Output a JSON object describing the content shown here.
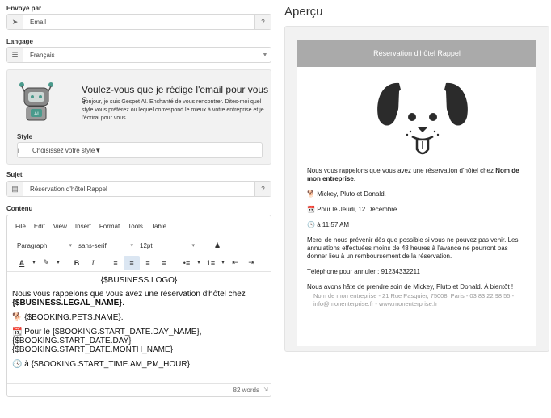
{
  "form": {
    "sender_label": "Envoyé par",
    "sender_value": "Email",
    "language_label": "Langage",
    "language_value": "Français",
    "ai": {
      "title": "Voulez-vous que je rédige l'email pour vous ?",
      "text": "Bonjour, je suis Gespet AI. Enchanté de vous rencontrer. Dites-moi quel style vous préférez ou lequel correspond le mieux à votre entreprise et je l'écrirai pour vous.",
      "style_label": "Style",
      "style_placeholder": "Choisissez votre style",
      "robot_badge": "AI"
    },
    "subject_label": "Sujet",
    "subject_value": "Réservation d'hôtel Rappel",
    "content_label": "Contenu"
  },
  "editor": {
    "menu": [
      "File",
      "Edit",
      "View",
      "Insert",
      "Format",
      "Tools",
      "Table"
    ],
    "block_format": "Paragraph",
    "font_family": "sans-serif",
    "font_size": "12pt",
    "logo_token": "{$BUSINESS.LOGO}",
    "line1": "Nous vous rappelons que vous avez une réservation d'hôtel chez",
    "line1_bold": "{$BUSINESS.LEGAL_NAME}",
    "pets": "{$BOOKING.PETS.NAME}.",
    "date_line1": "Pour le {$BOOKING.START_DATE.DAY_NAME},",
    "date_line2": "{$BOOKING.START_DATE.DAY}",
    "date_line3": "{$BOOKING.START_DATE.MONTH_NAME}",
    "time_line": "à {$BOOKING.START_TIME.AM_PM_HOUR}",
    "word_count": "82 words"
  },
  "preview": {
    "title": "Aperçu",
    "mail_header": "Réservation d'hôtel Rappel",
    "intro": "Nous vous rappelons que vous avez une réservation d'hôtel chez",
    "business_name": "Nom de mon entreprise",
    "pets": "Mickey, Pluto et Donald.",
    "date": "Pour le Jeudi, 12 Décembre",
    "time": "à 11:57 AM",
    "notice": "Merci de nous prévenir dès que possible si vous ne pouvez pas venir. Les annulations effectuées moins de 48 heures à l'avance ne pourront pas donner lieu à un remboursement de la réservation.",
    "phone": "Téléphone pour annuler : 91234332211",
    "closing": "Nous avons hâte de prendre soin de Mickey, Pluto et Donald. À bientôt !",
    "footer": "Nom de mon entreprise - 21 Rue Pasquier, 75008, Paris - 03 83 22 98 55 - info@monenterprise.fr - www.monenterprise.fr"
  },
  "colors": {
    "mail_header_bg": "#aaaaaa",
    "active_toolbar": "#dbe6f2",
    "robot_green": "#4a9a8c"
  }
}
